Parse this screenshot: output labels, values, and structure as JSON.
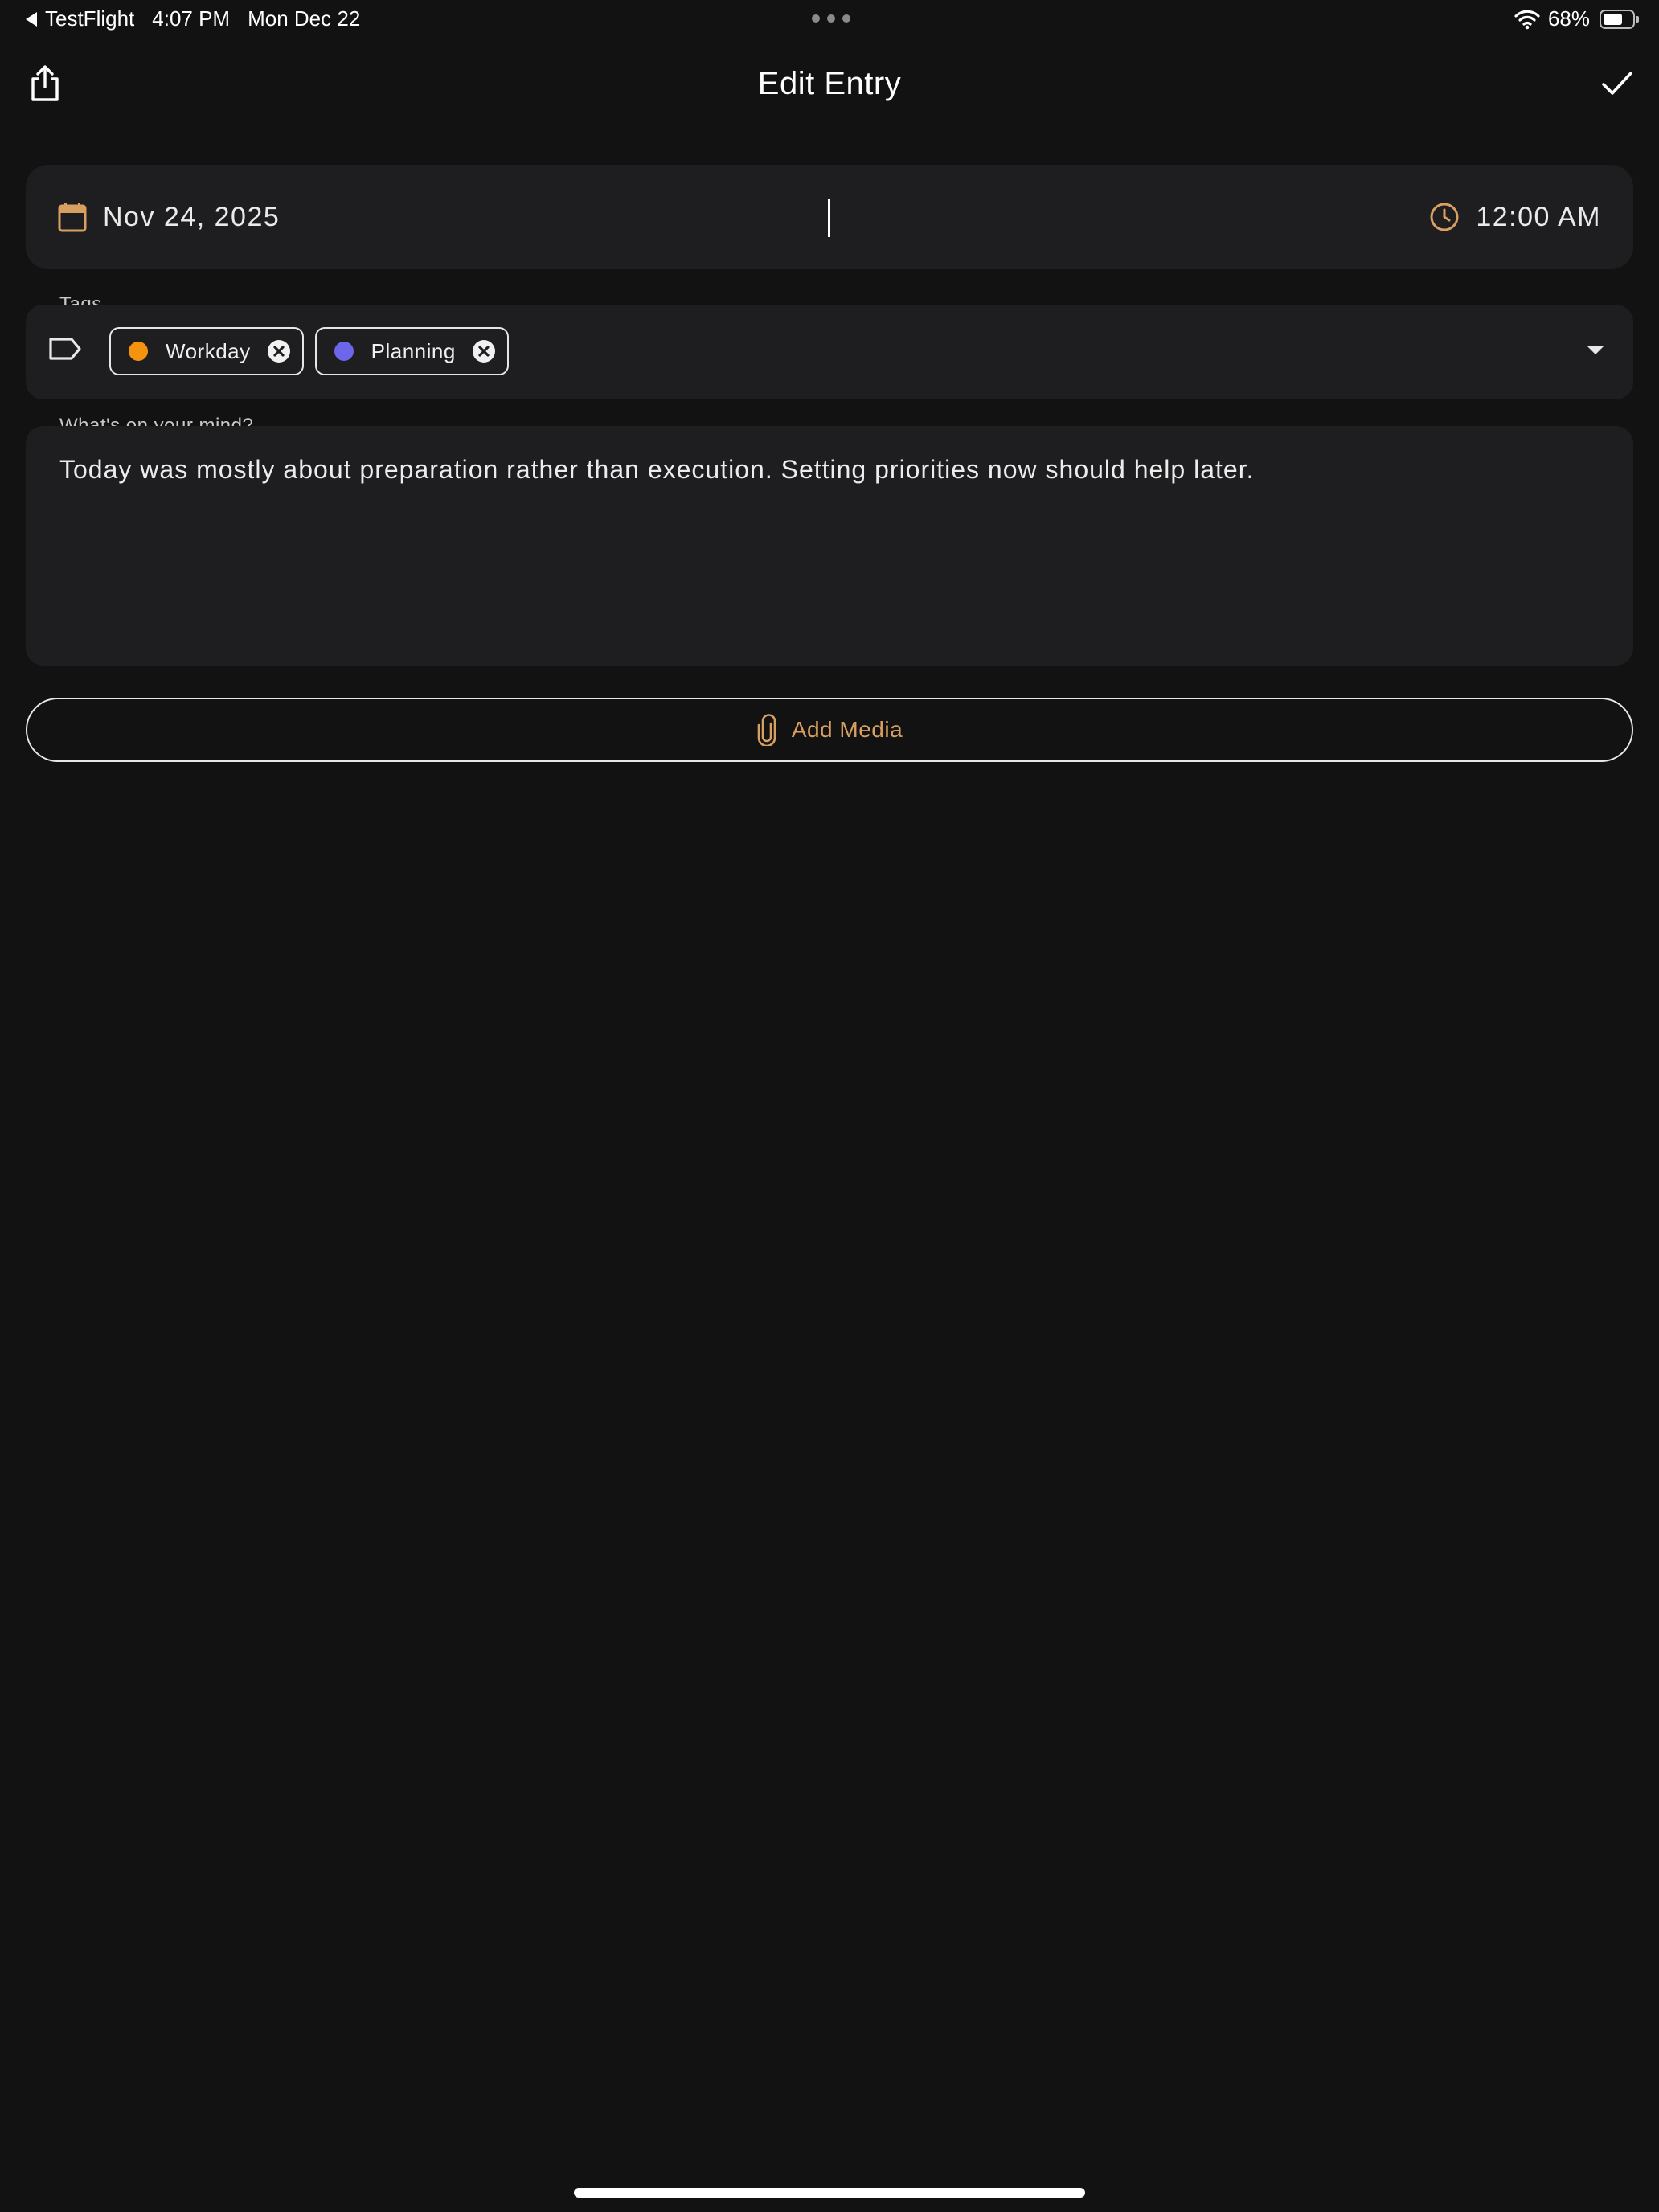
{
  "status_bar": {
    "back_app": "TestFlight",
    "time": "4:07 PM",
    "date": "Mon Dec 22",
    "battery": "68%",
    "battery_level": 0.68
  },
  "nav": {
    "title": "Edit Entry",
    "share_icon": "share-icon",
    "confirm_icon": "checkmark-icon"
  },
  "datetime": {
    "date": "Nov 24, 2025",
    "time": "12:00 AM",
    "date_icon": "calendar-icon",
    "time_icon": "clock-icon"
  },
  "tags": {
    "label": "Tags",
    "icon": "tag-icon",
    "items": [
      {
        "label": "Workday",
        "color": "#f5930f"
      },
      {
        "label": "Planning",
        "color": "#6b66ea"
      }
    ]
  },
  "entry": {
    "label": "What's on your mind?",
    "text": "Today was mostly about preparation rather than execution. Setting priorities now should help later."
  },
  "media": {
    "label": "Add Media",
    "icon": "paperclip-icon"
  },
  "colors": {
    "background": "#121212",
    "card": "#1e1e20",
    "accent": "#d8a060"
  }
}
